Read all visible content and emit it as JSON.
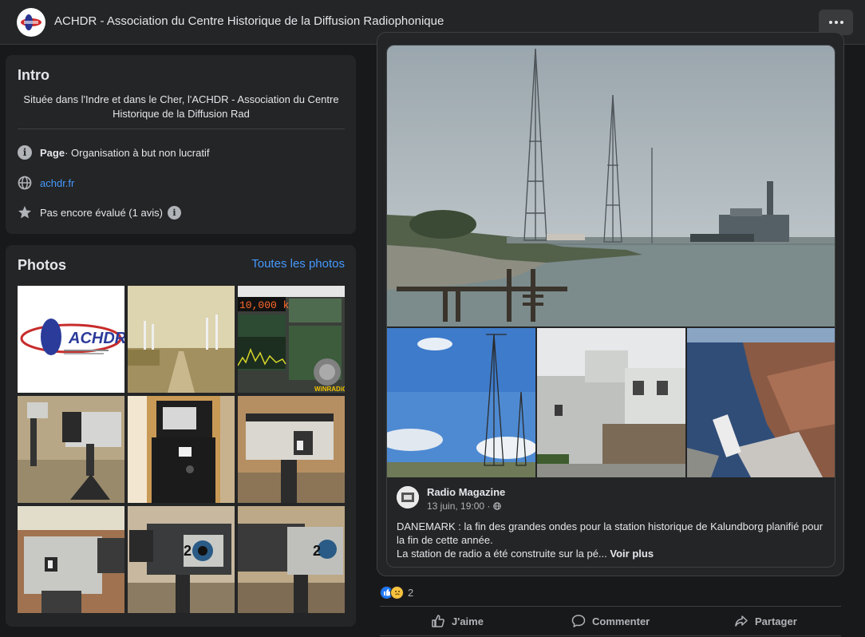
{
  "header": {
    "title": "ACHDR - Association du Centre Historique de la Diffusion Radiophonique",
    "logo_text": "ACHDR",
    "more_icon": "ellipsis-icon"
  },
  "intro": {
    "title": "Intro",
    "description": "Située dans l'Indre et dans le Cher, l'ACHDR - Association du Centre Historique de la Diffusion Rad",
    "page_label": "Page",
    "page_category": " · Organisation à but non lucratif",
    "website": "achdr.fr",
    "rating": "Pas encore évalué (1 avis)"
  },
  "photos": {
    "title": "Photos",
    "see_all": "Toutes les photos",
    "tiles": [
      "achdr-logo",
      "road-masts",
      "winradio-screen",
      "tv-camera",
      "tv-camera-front",
      "tv-camera-side",
      "camera-1",
      "camera-2-alsace",
      "camera-2-alsace"
    ]
  },
  "post": {
    "author": "Radio Magazine",
    "date": "13 juin, 19:00 · ",
    "text_line1": "DANEMARK : la fin des grandes ondes pour la station historique de Kalundborg planifié pour la fin de cette année.",
    "text_line2": "La station de radio a été construite sur la pé...",
    "see_more": " Voir plus",
    "reaction_count": "2",
    "actions": {
      "like": "J'aime",
      "comment": "Commenter",
      "share": "Partager"
    }
  },
  "colors": {
    "background": "#18191a",
    "card": "#242526",
    "link": "#4599ff",
    "text": "#e4e6eb",
    "muted": "#b0b3b8"
  }
}
